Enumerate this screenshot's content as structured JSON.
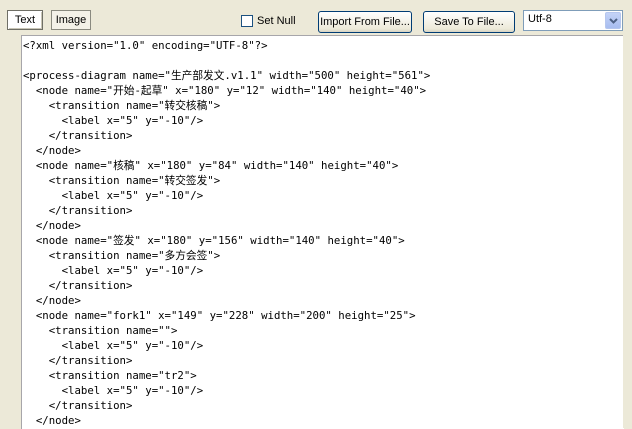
{
  "tabs": [
    {
      "label": "Text"
    },
    {
      "label": "Image"
    }
  ],
  "set_null": {
    "label": "Set Null",
    "checked": false
  },
  "buttons": {
    "import_label": "Import From File...",
    "save_label": "Save To File..."
  },
  "encoding": {
    "selected": "Utf-8"
  },
  "editor": {
    "lines": [
      "<?xml version=\"1.0\" encoding=\"UTF-8\"?>",
      "",
      "<process-diagram name=\"生产部发文.v1.1\" width=\"500\" height=\"561\">",
      "  <node name=\"开始-起草\" x=\"180\" y=\"12\" width=\"140\" height=\"40\">",
      "    <transition name=\"转交核稿\">",
      "      <label x=\"5\" y=\"-10\"/>",
      "    </transition>",
      "  </node>",
      "  <node name=\"核稿\" x=\"180\" y=\"84\" width=\"140\" height=\"40\">",
      "    <transition name=\"转交签发\">",
      "      <label x=\"5\" y=\"-10\"/>",
      "    </transition>",
      "  </node>",
      "  <node name=\"签发\" x=\"180\" y=\"156\" width=\"140\" height=\"40\">",
      "    <transition name=\"多方会签\">",
      "      <label x=\"5\" y=\"-10\"/>",
      "    </transition>",
      "  </node>",
      "  <node name=\"fork1\" x=\"149\" y=\"228\" width=\"200\" height=\"25\">",
      "    <transition name=\"\">",
      "      <label x=\"5\" y=\"-10\"/>",
      "    </transition>",
      "    <transition name=\"tr2\">",
      "      <label x=\"5\" y=\"-10\"/>",
      "    </transition>",
      "  </node>"
    ]
  }
}
